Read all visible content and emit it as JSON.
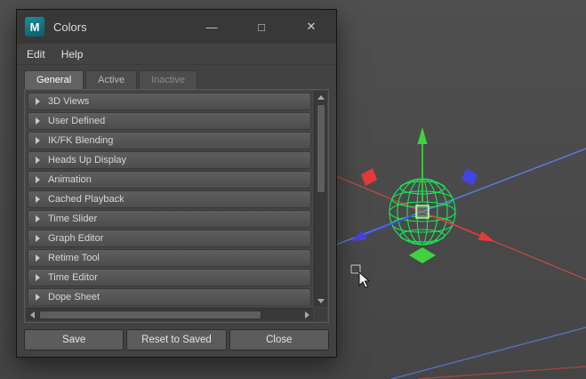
{
  "window": {
    "title": "Colors",
    "icon_letter": "M",
    "controls": {
      "minimize": "—",
      "maximize": "□",
      "close": "✕"
    }
  },
  "menu": {
    "items": [
      {
        "label": "Edit"
      },
      {
        "label": "Help"
      }
    ]
  },
  "tabs": [
    {
      "label": "General",
      "active": true
    },
    {
      "label": "Active",
      "active": false
    },
    {
      "label": "Inactive",
      "active": false
    }
  ],
  "panel": {
    "sections": [
      "3D Views",
      "User Defined",
      "IK/FK Blending",
      "Heads Up Display",
      "Animation",
      "Cached Playback",
      "Time Slider",
      "Graph Editor",
      "Retime Tool",
      "Time Editor",
      "Dope Sheet"
    ]
  },
  "footer": {
    "buttons": [
      {
        "label": "Save"
      },
      {
        "label": "Reset to Saved"
      },
      {
        "label": "Close"
      }
    ]
  },
  "icons": {
    "expand_arrow": "collapsed-section-triangle",
    "scrollbar": "up/down/left/right arrows",
    "app": "maya-logo"
  },
  "colors": {
    "window_bg": "#424242",
    "titlebar_bg": "#383838",
    "tab_active_bg": "#636363",
    "row_gradient_top": "#5e5e5e",
    "button_bg": "#5c5c5c",
    "accent_teal": "#17919f",
    "viewport_bg": "#4a4a4a",
    "axis_x": "#b84a4a",
    "axis_z": "#5b7fe8",
    "manip_x": "#e33a3a",
    "manip_y": "#3fd43f",
    "manip_z": "#4444e0",
    "selection": "#1de75a",
    "center_box": "#e4f0bc"
  }
}
